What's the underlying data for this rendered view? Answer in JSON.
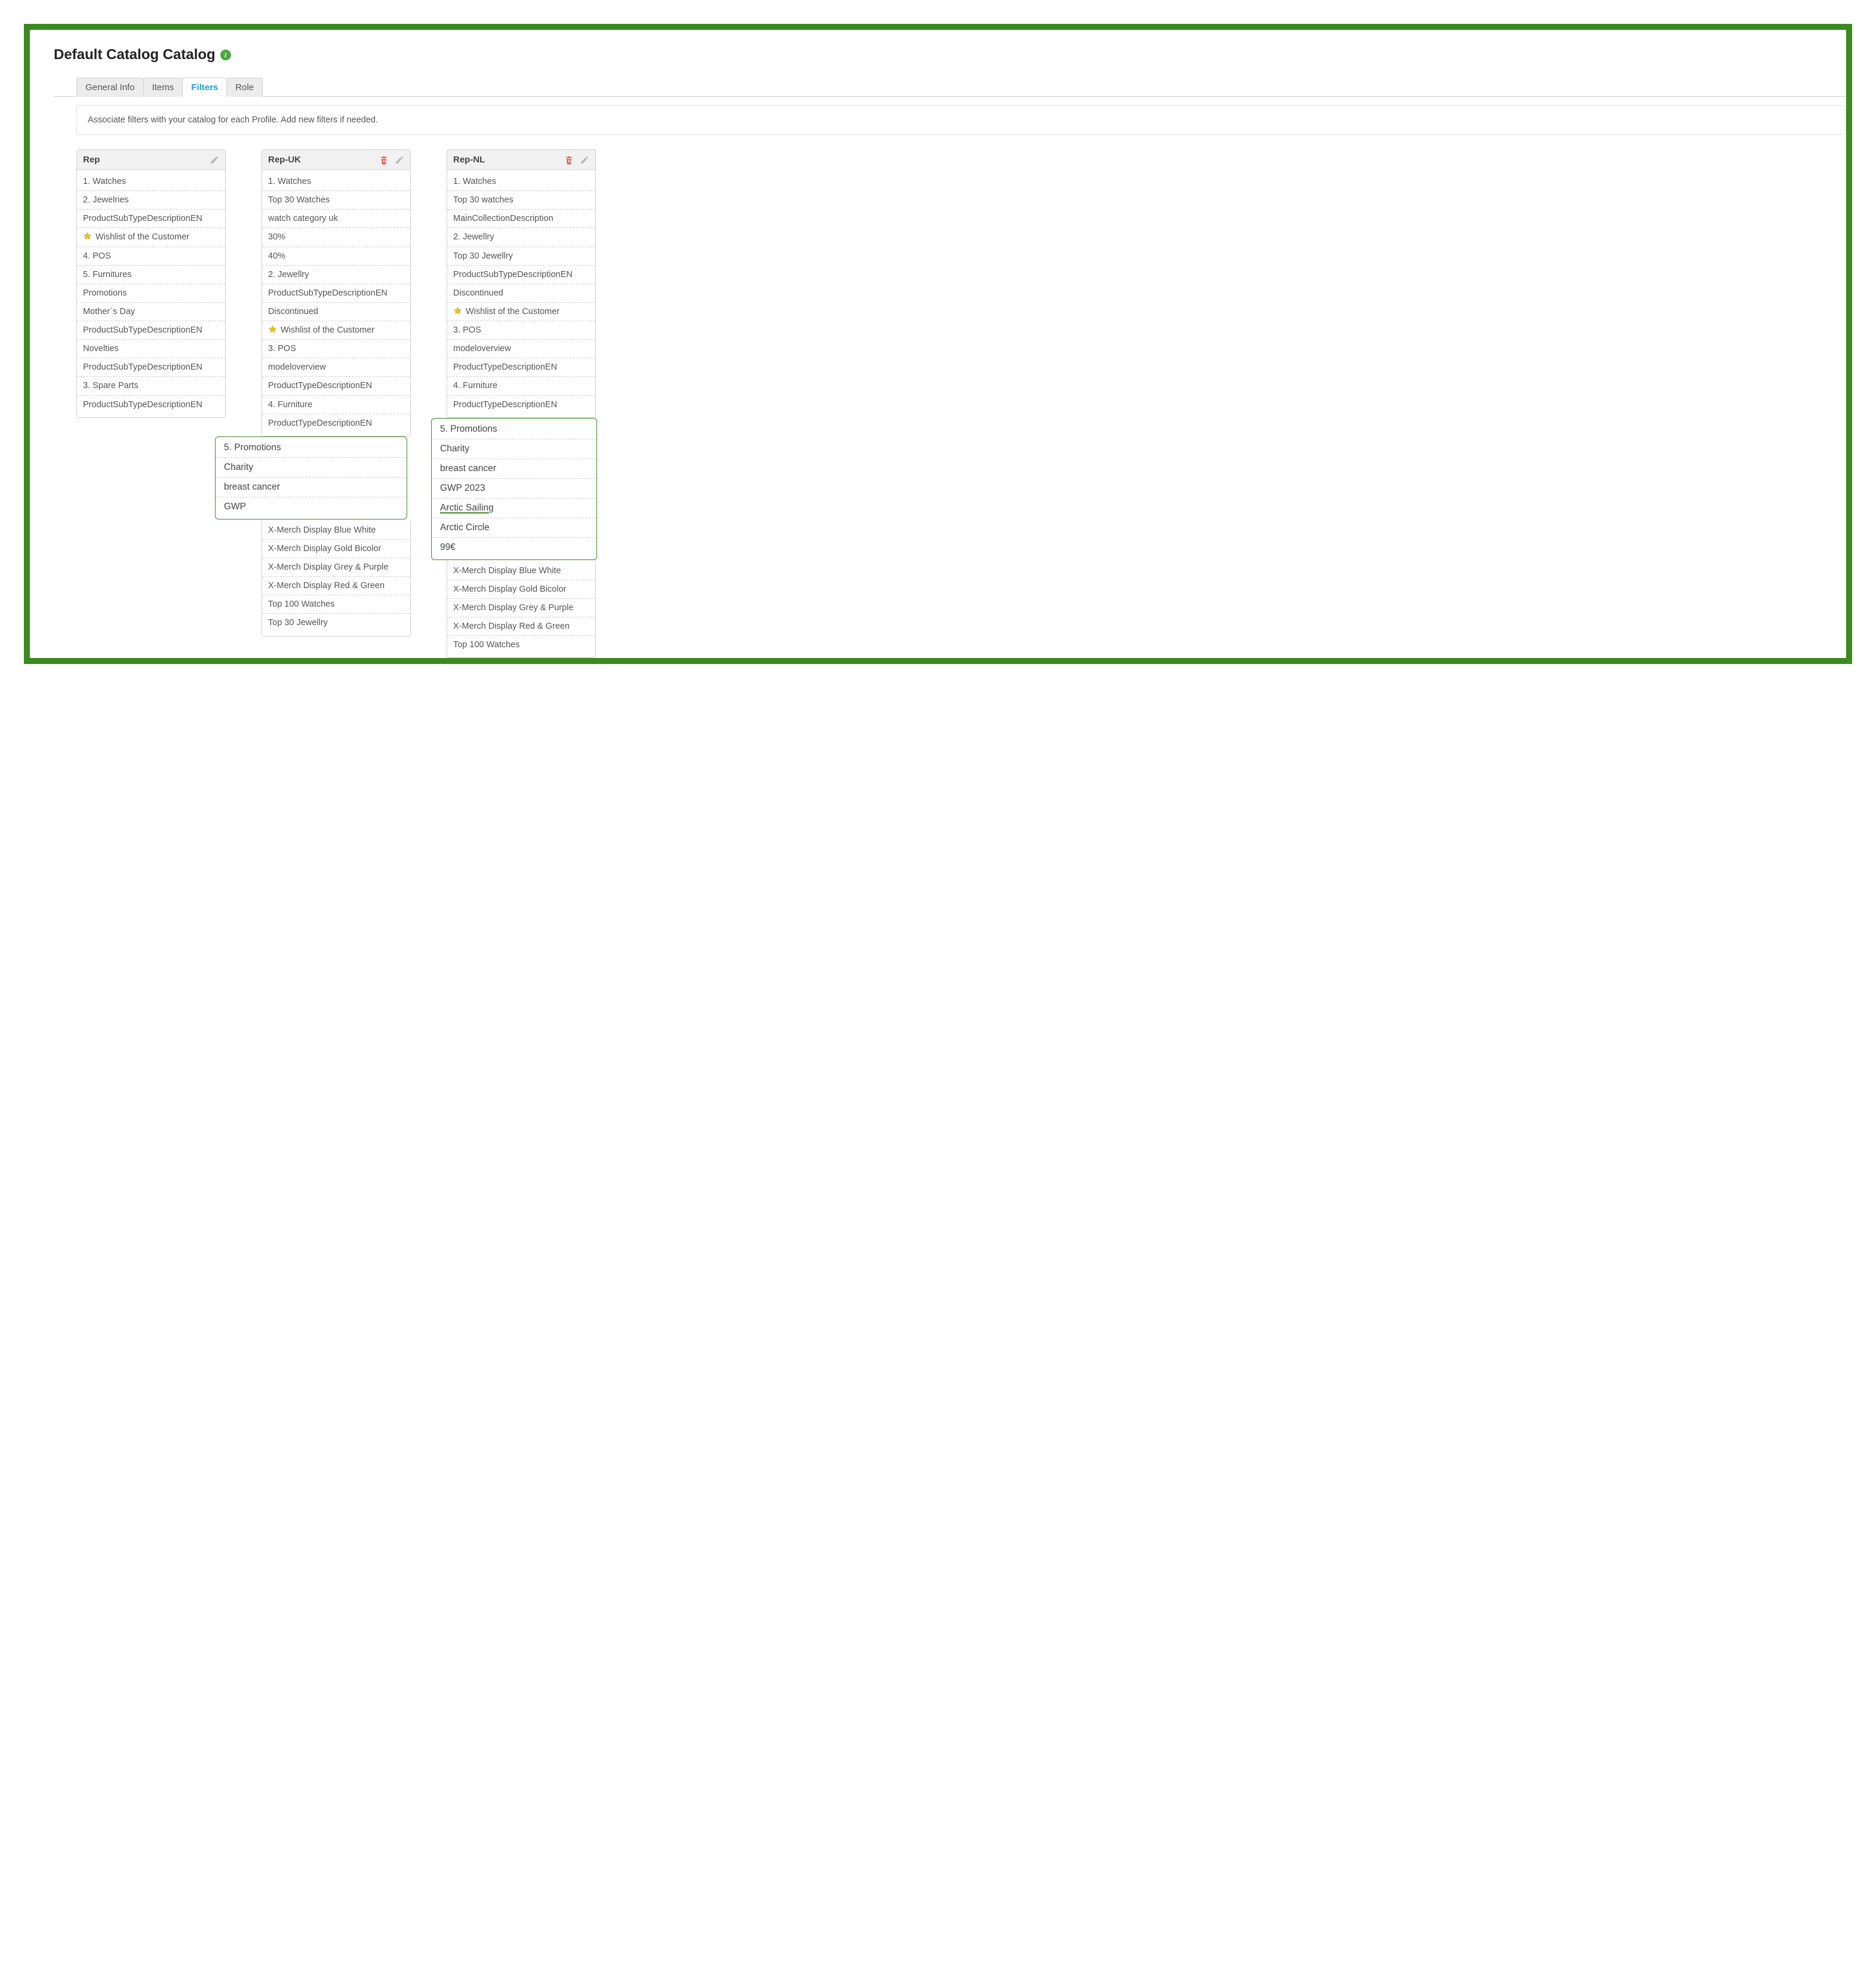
{
  "page_title": "Default Catalog Catalog",
  "tabs": [
    "General Info",
    "Items",
    "Filters",
    "Role"
  ],
  "active_tab_index": 2,
  "helper_text": "Associate filters with your catalog for each Profile. Add new filters if needed.",
  "columns": [
    {
      "title": "Rep",
      "show_delete": false,
      "items_before": [
        {
          "label": "1. Watches"
        },
        {
          "label": "2. Jewelries"
        },
        {
          "label": "ProductSubTypeDescriptionEN"
        },
        {
          "label": "Wishlist of the Customer",
          "star": true
        },
        {
          "label": "4. POS"
        },
        {
          "label": "5. Furnitures"
        },
        {
          "label": "Promotions"
        },
        {
          "label": "Mother´s Day"
        },
        {
          "label": "ProductSubTypeDescriptionEN"
        },
        {
          "label": "Novelties"
        },
        {
          "label": "ProductSubTypeDescriptionEN"
        },
        {
          "label": "3. Spare Parts"
        },
        {
          "label": "ProductSubTypeDescriptionEN"
        }
      ],
      "highlight": null,
      "items_after": []
    },
    {
      "title": "Rep-UK",
      "show_delete": true,
      "items_before": [
        {
          "label": "1. Watches"
        },
        {
          "label": "Top 30 Watches"
        },
        {
          "label": "watch category uk"
        },
        {
          "label": "30%"
        },
        {
          "label": "40%"
        },
        {
          "label": "2. Jewellry"
        },
        {
          "label": "ProductSubTypeDescriptionEN"
        },
        {
          "label": "Discontinued"
        },
        {
          "label": "Wishlist of the Customer",
          "star": true
        },
        {
          "label": "3. POS"
        },
        {
          "label": "modeloverview"
        },
        {
          "label": "ProductTypeDescriptionEN"
        },
        {
          "label": "4. Furniture"
        },
        {
          "label": "ProductTypeDescriptionEN"
        }
      ],
      "highlight": [
        {
          "label": "5. Promotions"
        },
        {
          "label": "Charity"
        },
        {
          "label": "breast cancer"
        },
        {
          "label": "GWP"
        }
      ],
      "items_after": [
        {
          "label": "X-Merch Display Blue White"
        },
        {
          "label": "X-Merch Display Gold Bicolor"
        },
        {
          "label": "X-Merch Display Grey & Purple"
        },
        {
          "label": "X-Merch Display Red & Green"
        },
        {
          "label": "Top 100 Watches"
        },
        {
          "label": "Top 30 Jewellry"
        }
      ]
    },
    {
      "title": "Rep-NL",
      "show_delete": true,
      "items_before": [
        {
          "label": "1. Watches"
        },
        {
          "label": "Top 30 watches"
        },
        {
          "label": "MainCollectionDescription"
        },
        {
          "label": "2. Jewellry"
        },
        {
          "label": "Top 30 Jewellry"
        },
        {
          "label": "ProductSubTypeDescriptionEN"
        },
        {
          "label": "Discontinued"
        },
        {
          "label": "Wishlist of the Customer",
          "star": true
        },
        {
          "label": "3. POS"
        },
        {
          "label": "modeloverview"
        },
        {
          "label": "ProductTypeDescriptionEN"
        },
        {
          "label": "4. Furniture"
        },
        {
          "label": "ProductTypeDescriptionEN"
        }
      ],
      "highlight": [
        {
          "label": "5. Promotions"
        },
        {
          "label": "Charity"
        },
        {
          "label": "breast cancer"
        },
        {
          "label": "GWP 2023"
        },
        {
          "label": "Arctic Sailing",
          "underline": true
        },
        {
          "label": "Arctic Circle"
        },
        {
          "label": "99€"
        }
      ],
      "items_after": [
        {
          "label": "X-Merch Display Blue White"
        },
        {
          "label": "X-Merch Display Gold Bicolor"
        },
        {
          "label": "X-Merch Display Grey & Purple"
        },
        {
          "label": "X-Merch Display Red & Green"
        },
        {
          "label": "Top 100 Watches"
        }
      ]
    }
  ]
}
